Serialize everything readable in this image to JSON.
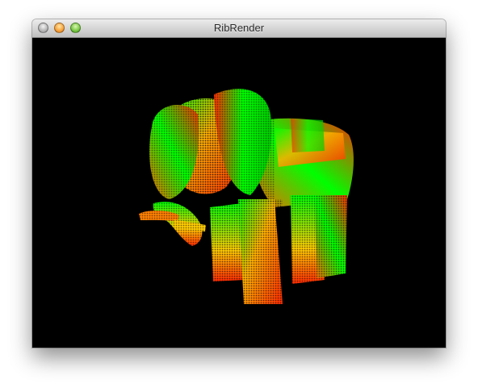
{
  "window": {
    "title": "RibRender",
    "controls": [
      {
        "name": "close",
        "icon": "close-disabled-icon",
        "color": "#a9a9a9"
      },
      {
        "name": "minimize",
        "icon": "minimize-icon",
        "color": "#f7a13a"
      },
      {
        "name": "zoom",
        "icon": "zoom-icon",
        "color": "#78c843"
      }
    ]
  },
  "viewport": {
    "background": "#000000",
    "subject": "elephant-model",
    "colors": [
      "#00ff00",
      "#ff2a00",
      "#ffb000"
    ]
  }
}
